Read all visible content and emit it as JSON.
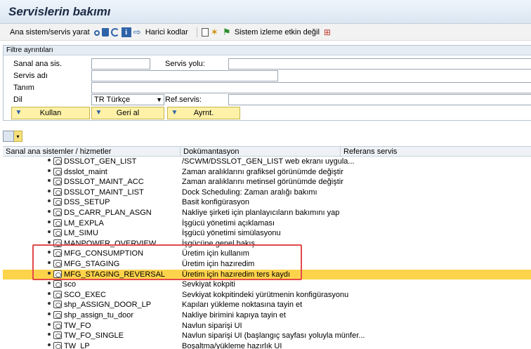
{
  "window": {
    "title": "Servislerin bakımı"
  },
  "toolbar": {
    "create_label": "Ana sistem/servis yarat",
    "external_label": "Harici kodlar",
    "monitor_label": "Sistem izleme etkin değil"
  },
  "filter": {
    "section_title": "Filtre ayrıntıları",
    "virtual_host_label": "Sanal ana sis.",
    "service_path_label": "Servis yolu:",
    "service_name_label": "Servis adı",
    "description_label": "Tanım",
    "language_label": "Dil",
    "language_value": "TR Türkçe",
    "ref_service_label": "Ref.servis:",
    "apply_label": "Kullan",
    "reset_label": "Geri al",
    "details_label": "Ayrnt."
  },
  "tree": {
    "columns": [
      "Sanal ana sistemler / hizmetler",
      "Dokümantasyon",
      "Referans servis"
    ],
    "rows": [
      {
        "name": "DSSLOT_GEN_LIST",
        "doc": "/SCWM/DSSLOT_GEN_LIST web ekranı uygula..."
      },
      {
        "name": "dsslot_maint",
        "doc": "Zaman aralıklarını grafiksel görünümde değiştir"
      },
      {
        "name": "DSSLOT_MAINT_ACC",
        "doc": "Zaman aralıklarını metinsel görünümde değiştir"
      },
      {
        "name": "DSSLOT_MAINT_LIST",
        "doc": "Dock Scheduling: Zaman aralığı bakımı"
      },
      {
        "name": "DSS_SETUP",
        "doc": "Basit konfigürasyon"
      },
      {
        "name": "DS_CARR_PLAN_ASGN",
        "doc": "Nakliye şirketi için planlayıcıların bakımını yap"
      },
      {
        "name": "LM_EXPLA",
        "doc": "İşgücü yönetimi açıklaması"
      },
      {
        "name": "LM_SIMU",
        "doc": "İşgücü yönetimi simülasyonu"
      },
      {
        "name": "MANPOWER_OVERVIEW",
        "doc": "İşgücüne genel bakış"
      },
      {
        "name": "MFG_CONSUMPTION",
        "doc": "Üretim için kullanım"
      },
      {
        "name": "MFG_STAGING",
        "doc": "Üretim için hazıredim"
      },
      {
        "name": "MFG_STAGING_REVERSAL",
        "doc": "Üretim için hazıredim ters kaydı",
        "selected": true
      },
      {
        "name": "sco",
        "doc": "Sevkiyat kokpiti"
      },
      {
        "name": "SCO_EXEC",
        "doc": "Sevkiyat kokpitindeki yürütmenin konfigürasyonu"
      },
      {
        "name": "shp_ASSIGN_DOOR_LP",
        "doc": "Kapıları yükleme noktasına tayin et"
      },
      {
        "name": "shp_assign_tu_door",
        "doc": "Nakliye birimini kapıya tayin et"
      },
      {
        "name": "TW_FO",
        "doc": "Navlun siparişi UI"
      },
      {
        "name": "TW_FO_SINGLE",
        "doc": "Navlun siparişi UI (başlangıç sayfası yoluyla münfer..."
      },
      {
        "name": "TW_LP",
        "doc": "Boşaltma/yükleme hazırlık UI"
      }
    ]
  },
  "colors": {
    "selected_row": "#fdd34b",
    "highlight_border": "#e24a4a",
    "button_bg": "#fff2a8"
  }
}
